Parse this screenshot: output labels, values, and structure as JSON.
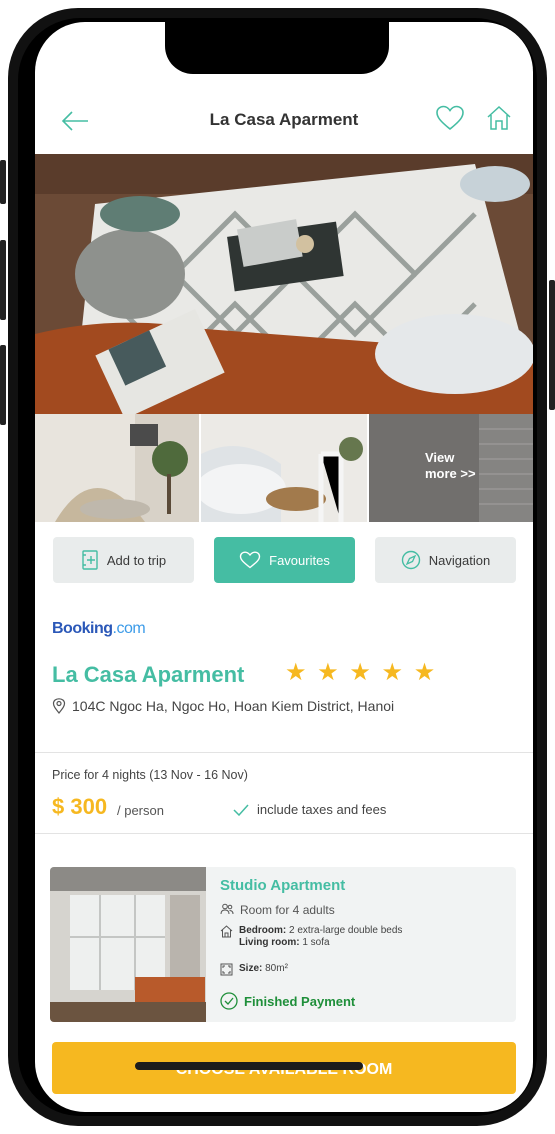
{
  "header": {
    "title": "La Casa Aparment"
  },
  "gallery": {
    "view_more_line1": "View",
    "view_more_line2": "more >>"
  },
  "actions": {
    "add_to_trip": "Add to trip",
    "favourites": "Favourites",
    "navigation": "Navigation"
  },
  "booking": {
    "brand": "Booking",
    "brand_suffix": ".com"
  },
  "hotel": {
    "name": "La Casa Aparment",
    "stars": "★ ★ ★ ★ ★",
    "address": "104C Ngoc Ha, Ngoc Ho, Hoan Kiem District, Hanoi"
  },
  "price": {
    "label": "Price for 4 nights (13 Nov - 16 Nov)",
    "amount": "$ 300",
    "per": "/ person",
    "taxes": "include taxes and fees"
  },
  "room": {
    "title": "Studio Apartment",
    "capacity": "Room for 4 adults",
    "bedroom_label": "Bedroom:",
    "bedroom_value": "2 extra-large double beds",
    "living_label": "Living room:",
    "living_value": "1 sofa",
    "size_label": "Size:",
    "size_value": "80m²",
    "status": "Finished Payment"
  },
  "cta": {
    "label": "CHOOSE AVAILABLE ROOM"
  },
  "colors": {
    "accent": "#45bda3",
    "star": "#f6b820",
    "cta": "#f6b820",
    "paid": "#1f8f3a",
    "booking": "#2b58b8"
  },
  "icons": [
    "back-arrow-icon",
    "heart-icon",
    "home-icon",
    "add-trip-icon",
    "heart-icon",
    "compass-icon",
    "location-pin-icon",
    "check-icon",
    "people-icon",
    "house-icon",
    "size-icon",
    "check-circle-icon"
  ]
}
